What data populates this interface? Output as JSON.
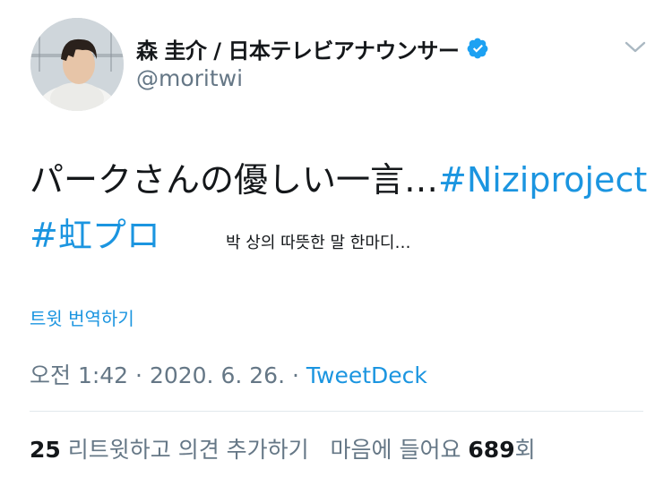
{
  "author": {
    "display_name": "森 圭介 / 日本テレビアナウンサー",
    "handle": "@moritwi",
    "verified": true,
    "verified_color": "#1da1f2"
  },
  "tweet": {
    "line1_text": "パークさんの優しい一言…",
    "hashtag1": "#Niziproject",
    "hashtag2": "#虹プロ",
    "overlay_caption": "박 상의 따뜻한 말 한마디…",
    "translate_label": "트윗 번역하기"
  },
  "meta": {
    "time": "오전 1:42",
    "separator": " · ",
    "date": "2020. 6. 26.",
    "separator2": " · ",
    "source": "TweetDeck"
  },
  "stats": {
    "retweets_count": "25",
    "retweets_label": "리트윗하고 의견 추가하기",
    "likes_prefix": "마음에 들어요",
    "likes_count": "689",
    "likes_suffix": "회"
  },
  "icons": {
    "avatar": "avatar",
    "verified": "verified-badge-icon",
    "more": "chevron-down-icon"
  },
  "colors": {
    "link": "#1b95e0",
    "text": "#14171a",
    "secondary": "#657786",
    "divider": "#e1e8ed"
  }
}
